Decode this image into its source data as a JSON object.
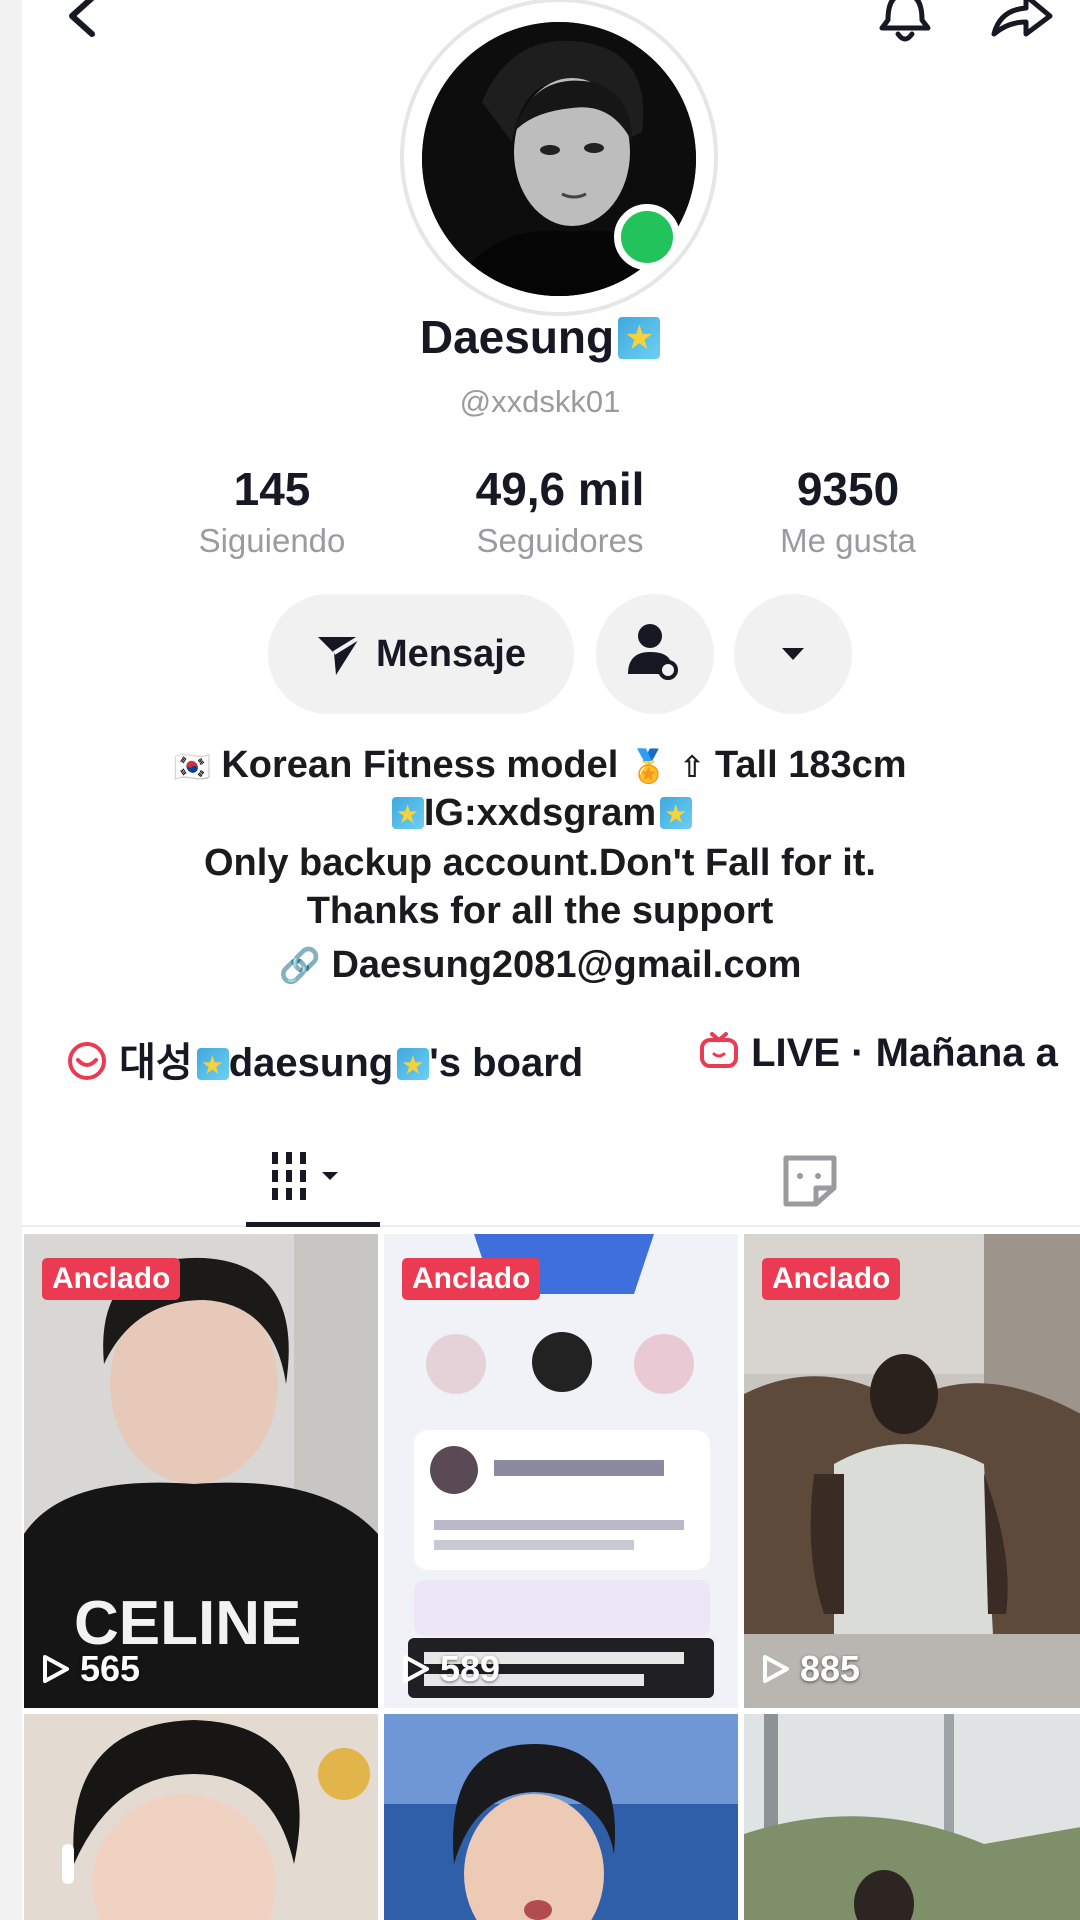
{
  "profile": {
    "name": "Daesung",
    "handle": "@xxdskk01"
  },
  "stats": [
    {
      "value": "145",
      "label": "Siguiendo"
    },
    {
      "value": "49,6 mil",
      "label": "Seguidores"
    },
    {
      "value": "9350",
      "label": "Me gusta"
    }
  ],
  "actions": {
    "message_label": "Mensaje"
  },
  "bio": {
    "line1_flag": "🇰🇷",
    "line1_text": "Korean Fitness model",
    "line1_medal": "🏅",
    "line1_tall": "Tall 183cm",
    "line2": "IG:xxdsgram",
    "line3": "Only backup account.Don't Fall for it.",
    "line4": "Thanks for all the support",
    "email": "Daesung2081@gmail.com"
  },
  "links": {
    "board_prefix": "대성",
    "board_middle": "daesung",
    "board_suffix": "'s board",
    "live": "LIVE · Mañana a"
  },
  "videos": [
    {
      "badge": "Anclado",
      "views": "565",
      "caption": "CELINE"
    },
    {
      "badge": "Anclado",
      "views": "589",
      "caption": ""
    },
    {
      "badge": "Anclado",
      "views": "885",
      "caption": ""
    },
    {
      "badge": "",
      "views": "",
      "caption": ""
    },
    {
      "badge": "",
      "views": "",
      "caption": ""
    },
    {
      "badge": "",
      "views": "",
      "caption": ""
    }
  ],
  "colors": {
    "online": "#22c35b",
    "badge": "#ea3b52",
    "link_icon": "#ea3b52"
  }
}
